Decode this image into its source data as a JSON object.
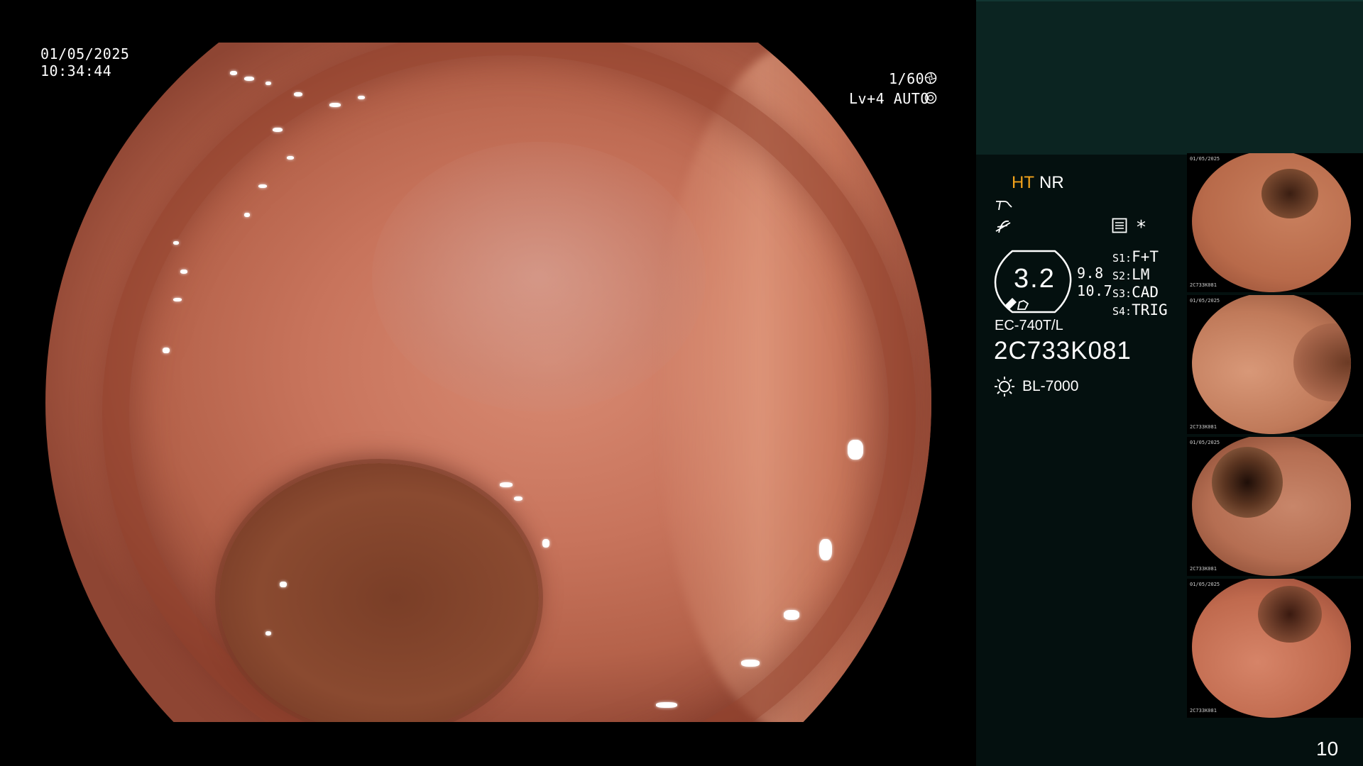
{
  "osd": {
    "date": "01/05/2025",
    "time": "10:34:44",
    "shutter": "1/60",
    "level": "Lv+4 AUTO"
  },
  "panel": {
    "mode_ht": "HT",
    "mode_nr": "NR",
    "zoom": "3.2",
    "value_a": "9.8",
    "value_b": "10.7",
    "switches": [
      {
        "key": "S1:",
        "value": "F+T"
      },
      {
        "key": "S2:",
        "value": "LM"
      },
      {
        "key": "S3:",
        "value": "CAD"
      },
      {
        "key": "S4:",
        "value": "TRIG"
      }
    ],
    "asterisk": "*",
    "scope_model": "EC-740T/L",
    "scope_serial": "2C733K081",
    "light_source": "BL-7000",
    "image_count": "10"
  },
  "thumbnails": [
    {
      "label": "thumbnail-1",
      "serial": "2C733K081"
    },
    {
      "label": "thumbnail-2",
      "serial": "2C733K081"
    },
    {
      "label": "thumbnail-3",
      "serial": "2C733K081"
    },
    {
      "label": "thumbnail-4",
      "serial": "2C733K081"
    }
  ],
  "colors": {
    "accent_ht": "#f2a21b",
    "panel_bg": "#04100f",
    "banner_bg": "#0b2421"
  }
}
